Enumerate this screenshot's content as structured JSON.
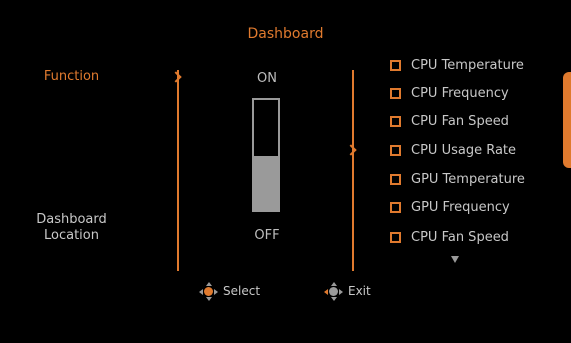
{
  "title": "Dashboard",
  "menu": {
    "function_label": "Function",
    "dashboard_location_label": "Dashboard\nLocation"
  },
  "toggle": {
    "on_label": "ON",
    "off_label": "OFF",
    "value": "OFF"
  },
  "options": [
    "CPU Temperature",
    "CPU Frequency",
    "CPU Fan Speed",
    "CPU Usage Rate",
    "GPU Temperature",
    "GPU Frequency",
    "CPU Fan Speed"
  ],
  "hints": {
    "select_label": "Select",
    "exit_label": "Exit"
  },
  "colors": {
    "accent": "#e07a2e",
    "text": "#c8c8c8",
    "gray": "#9a9a9a",
    "background": "#000000"
  },
  "icons": {
    "select": "joystick-icon",
    "exit": "joystick-icon",
    "scroll": "triangle-down-icon"
  }
}
